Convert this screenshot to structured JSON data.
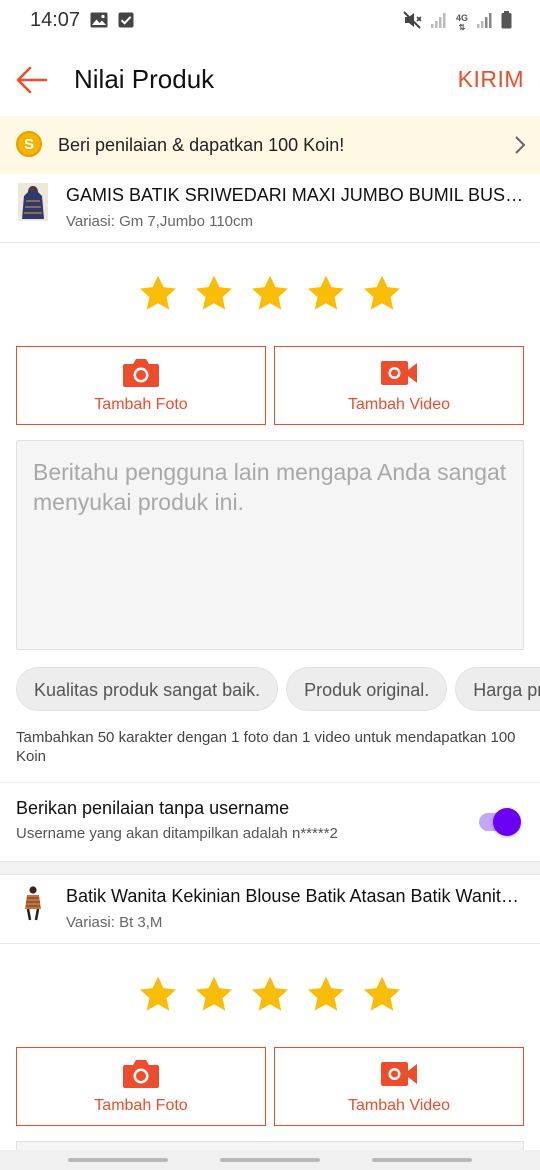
{
  "status_bar": {
    "time": "14:07",
    "left_icons": [
      "image-icon",
      "checkbox-icon"
    ],
    "right_icons": [
      "mute-icon",
      "signal-icon",
      "4g-icon",
      "signal-icon",
      "battery-icon"
    ],
    "network_label": "4G"
  },
  "app_bar": {
    "back_icon": "arrow-left-icon",
    "title": "Nilai Produk",
    "action_label": "KIRIM"
  },
  "coin_banner": {
    "coin_symbol": "S",
    "text": "Beri penilaian & dapatkan 100 Koin!",
    "chevron_icon": "chevron-right-icon"
  },
  "products": [
    {
      "name": "GAMIS BATIK SRIWEDARI MAXI JUMBO BUMIL BUSUI MENYUSUI",
      "variant": "Variasi: Gm 7,Jumbo 110cm",
      "stars": 5,
      "stars_max": 5,
      "media_buttons": [
        {
          "label": "Tambah Foto",
          "icon": "camera-icon"
        },
        {
          "label": "Tambah Video",
          "icon": "video-camera-icon"
        }
      ],
      "review_placeholder": "Beritahu pengguna lain mengapa Anda sangat menyukai produk ini.",
      "review_value": "",
      "quick_chips": [
        "Kualitas produk sangat baik.",
        "Produk original.",
        "Harga produk sangat baik."
      ],
      "hint": "Tambahkan 50 karakter dengan 1 foto dan 1 video untuk mendapatkan 100 Koin",
      "anonymous": {
        "title": "Berikan penilaian tanpa username",
        "subtitle": "Username yang akan ditampilkan adalah n*****2",
        "enabled": true
      }
    },
    {
      "name": "Batik Wanita Kekinian Blouse Batik Atasan Batik Wanita Modern",
      "variant": "Variasi: Bt 3,M",
      "stars": 5,
      "stars_max": 5,
      "media_buttons": [
        {
          "label": "Tambah Foto",
          "icon": "camera-icon"
        },
        {
          "label": "Tambah Video",
          "icon": "video-camera-icon"
        }
      ]
    }
  ],
  "colors": {
    "accent": "#ee4d2d",
    "star": "#fbbc05",
    "banner_bg": "#fff8e4",
    "toggle_on": "#6a00f4",
    "toggle_track": "#c4a6f5"
  }
}
